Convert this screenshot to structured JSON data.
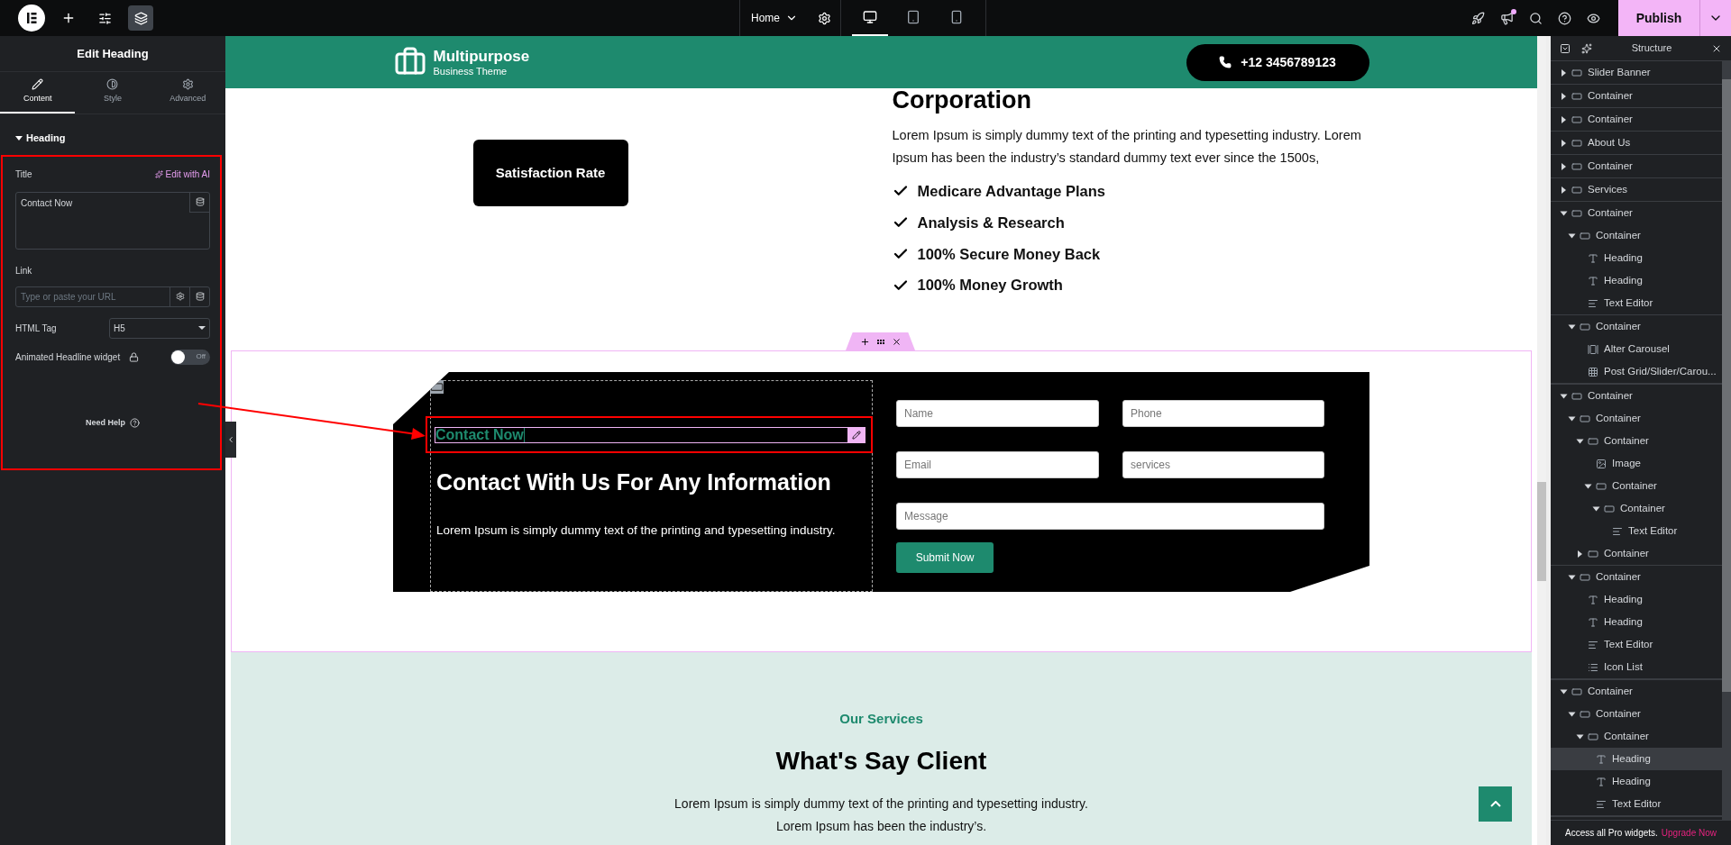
{
  "top_bar": {
    "page_menu": "Home",
    "devices": [
      {
        "kind": "desktop",
        "selected": true
      },
      {
        "kind": "tablet",
        "selected": false
      },
      {
        "kind": "mobile",
        "selected": false
      }
    ],
    "publish": "Publish"
  },
  "panel": {
    "title": "Edit Heading",
    "tabs": [
      {
        "label": "Content",
        "kind": "content",
        "selected": true
      },
      {
        "label": "Style",
        "kind": "style",
        "selected": false
      },
      {
        "label": "Advanced",
        "kind": "advanced",
        "selected": false
      }
    ],
    "section": {
      "title": "Heading",
      "expanded": true
    },
    "title_label": "Title",
    "ai_link": "Edit with AI",
    "title_value": "Contact Now",
    "link_label": "Link",
    "link_placeholder": "Type or paste your URL",
    "tag_label": "HTML Tag",
    "tag_value": "H5",
    "animated_label": "Animated Headline widget",
    "animated_toggle": {
      "on": false,
      "label": "Off"
    },
    "help": "Need Help"
  },
  "canvas": {
    "header": {
      "brand": "Multipurpose",
      "tagline": "Business Theme",
      "phone": "+12 3456789123"
    },
    "about": {
      "button": "Satisfaction Rate",
      "heading": "Corporation",
      "paragraph": "Lorem Ipsum is simply dummy text of the printing and typesetting industry. Lorem Ipsum has been the industry’s standard dummy text ever since the 1500s,",
      "checklist": [
        "Medicare Advantage Plans",
        "Analysis & Research",
        "100% Secure Money Back",
        "100% Money Growth"
      ]
    },
    "contact": {
      "eyebrow": "Contact Now",
      "heading": "Contact With Us For Any Information",
      "paragraph": "Lorem Ipsum is simply dummy text of the printing and typesetting industry.",
      "fields": [
        {
          "placeholder": "Name"
        },
        {
          "placeholder": "Phone"
        },
        {
          "placeholder": "Email"
        },
        {
          "placeholder": "services"
        },
        {
          "placeholder": "Message"
        }
      ],
      "submit": "Submit Now"
    },
    "services": {
      "eyebrow": "Our Services",
      "heading": "What's Say Client",
      "lines": [
        "Lorem Ipsum is simply dummy text of the printing and typesetting industry.",
        "Lorem Ipsum has been the industry’s."
      ]
    }
  },
  "structure": {
    "title": "Structure",
    "items": [
      {
        "label": "Slider Banner",
        "kind": "container",
        "expanded": false,
        "selected": false
      },
      {
        "label": "Container",
        "kind": "container",
        "expanded": false,
        "selected": false
      },
      {
        "label": "Container",
        "kind": "container",
        "expanded": false,
        "selected": false
      },
      {
        "label": "About Us",
        "kind": "container",
        "expanded": false,
        "selected": false
      },
      {
        "label": "Container",
        "kind": "container",
        "expanded": false,
        "selected": false
      },
      {
        "label": "Services",
        "kind": "container",
        "expanded": false,
        "selected": false
      },
      {
        "label": "Container",
        "kind": "container",
        "expanded": true,
        "selected": false,
        "children": [
          {
            "label": "Container",
            "kind": "container",
            "expanded": true,
            "selected": false,
            "children": [
              {
                "label": "Heading",
                "kind": "heading",
                "selected": false
              },
              {
                "label": "Heading",
                "kind": "heading",
                "selected": false
              },
              {
                "label": "Text Editor",
                "kind": "text",
                "selected": false
              }
            ]
          },
          {
            "label": "Container",
            "kind": "container",
            "expanded": true,
            "selected": false,
            "children": [
              {
                "label": "Alter Carousel",
                "kind": "carousel",
                "selected": false
              },
              {
                "label": "Post Grid/Slider/Carou...",
                "kind": "grid",
                "selected": false
              }
            ]
          }
        ]
      },
      {
        "label": "Container",
        "kind": "container",
        "expanded": true,
        "selected": false,
        "children": [
          {
            "label": "Container",
            "kind": "container",
            "expanded": true,
            "selected": false,
            "children": [
              {
                "label": "Container",
                "kind": "container",
                "expanded": true,
                "selected": false,
                "children": [
                  {
                    "label": "Image",
                    "kind": "image",
                    "selected": false
                  },
                  {
                    "label": "Container",
                    "kind": "container",
                    "expanded": true,
                    "selected": false,
                    "children": [
                      {
                        "label": "Container",
                        "kind": "container",
                        "expanded": true,
                        "selected": false,
                        "children": [
                          {
                            "label": "Text Editor",
                            "kind": "text",
                            "selected": false
                          }
                        ]
                      }
                    ]
                  }
                ]
              },
              {
                "label": "Container",
                "kind": "container",
                "expanded": false,
                "selected": false
              }
            ]
          },
          {
            "label": "Container",
            "kind": "container",
            "expanded": true,
            "selected": false,
            "children": [
              {
                "label": "Heading",
                "kind": "heading",
                "selected": false
              },
              {
                "label": "Heading",
                "kind": "heading",
                "selected": false
              },
              {
                "label": "Text Editor",
                "kind": "text",
                "selected": false
              },
              {
                "label": "Icon List",
                "kind": "list",
                "selected": false
              }
            ]
          }
        ]
      },
      {
        "label": "Container",
        "kind": "container",
        "expanded": true,
        "selected": false,
        "children": [
          {
            "label": "Container",
            "kind": "container",
            "expanded": true,
            "selected": false,
            "children": [
              {
                "label": "Container",
                "kind": "container",
                "expanded": true,
                "selected": false,
                "children": [
                  {
                    "label": "Heading",
                    "kind": "heading",
                    "selected": true
                  },
                  {
                    "label": "Heading",
                    "kind": "heading",
                    "selected": false
                  },
                  {
                    "label": "Text Editor",
                    "kind": "text",
                    "selected": false
                  }
                ]
              }
            ]
          }
        ]
      }
    ],
    "footer": "Access all Pro widgets.",
    "upgrade": "Upgrade Now"
  }
}
